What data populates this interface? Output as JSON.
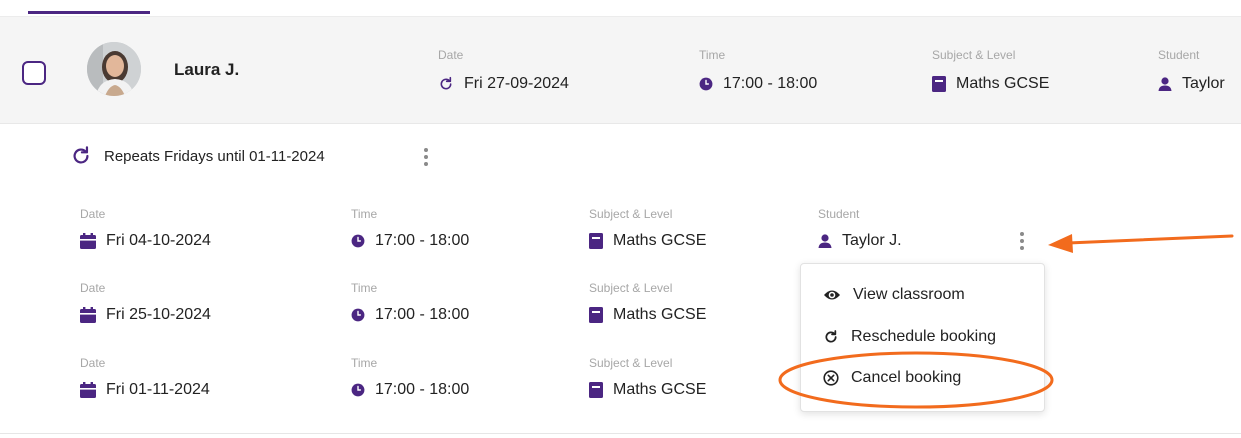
{
  "booking": {
    "tutor_name": "Laura J.",
    "date_label": "Date",
    "date": "Fri 27-09-2024",
    "time_label": "Time",
    "time": "17:00 - 18:00",
    "subject_label": "Subject & Level",
    "subject": "Maths GCSE",
    "student_label": "Student",
    "student": "Taylor"
  },
  "repeat": {
    "text": "Repeats Fridays until 01-11-2024"
  },
  "sessions": [
    {
      "date_label": "Date",
      "date": "Fri 04-10-2024",
      "time_label": "Time",
      "time": "17:00 - 18:00",
      "subject_label": "Subject & Level",
      "subject": "Maths GCSE",
      "student_label": "Student",
      "student": "Taylor J."
    },
    {
      "date_label": "Date",
      "date": "Fri 25-10-2024",
      "time_label": "Time",
      "time": "17:00 - 18:00",
      "subject_label": "Subject & Level",
      "subject": "Maths GCSE"
    },
    {
      "date_label": "Date",
      "date": "Fri 01-11-2024",
      "time_label": "Time",
      "time": "17:00 - 18:00",
      "subject_label": "Subject & Level",
      "subject": "Maths GCSE"
    }
  ],
  "menu": {
    "items": [
      {
        "label": "View classroom",
        "icon": "eye-icon"
      },
      {
        "label": "Reschedule booking",
        "icon": "reschedule-icon"
      },
      {
        "label": "Cancel booking",
        "icon": "cancel-circle-icon"
      }
    ]
  },
  "colors": {
    "accent": "#4b2682",
    "annotation": "#f26b1d",
    "row_background": "#f5f5f5",
    "label_gray": "#a7a7a7"
  }
}
